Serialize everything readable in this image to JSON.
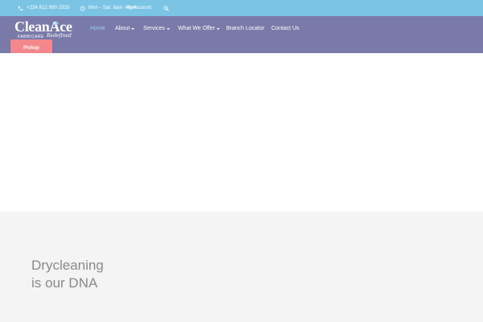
{
  "topbar": {
    "phone": "+234 812 990 2525",
    "hours": "Mon - Sat: 8am - 6pm",
    "account": "My Account",
    "icons": [
      "phone-icon",
      "clock-icon",
      "search-icon"
    ]
  },
  "logo": {
    "wordmark": "CleanAce",
    "tagline": "FABRICARE",
    "script": "Redefined"
  },
  "nav": {
    "items": [
      {
        "label": "Home",
        "active": true
      },
      {
        "label": "About",
        "dropdown": true
      },
      {
        "label": "Services",
        "dropdown": true
      },
      {
        "label": "What We Offer",
        "dropdown": true
      },
      {
        "label": "Branch Locator"
      },
      {
        "label": "Contact Us"
      }
    ]
  },
  "pickup": {
    "label": "Pickup"
  },
  "section": {
    "line1": "Drycleaning",
    "line2": "is our DNA"
  },
  "colors": {
    "topbar": "#7cc4e6",
    "navbar": "#7a7aaa",
    "active_link": "#8fd3f5",
    "pickup_button": "#f5878c",
    "section_bg": "#f4f4f4",
    "tagline_text": "#8a8a8a"
  }
}
